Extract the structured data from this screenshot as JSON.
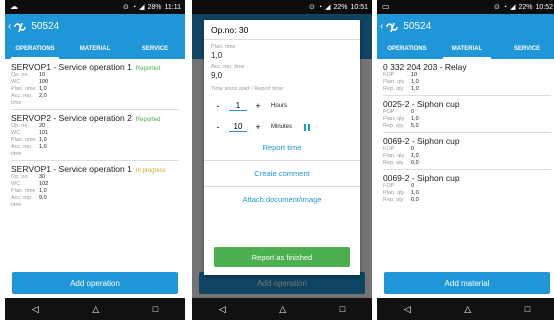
{
  "status_bar": [
    {
      "time": "11:11",
      "battery": "28%"
    },
    {
      "time": "10:51",
      "battery": "22%"
    },
    {
      "time": "10:52",
      "battery": "22%"
    }
  ],
  "app": {
    "title": "50524"
  },
  "tabs": [
    "OPERATIONS",
    "MATERIAL",
    "SERVICE"
  ],
  "operations": [
    {
      "name": "SERVOP1 - Service operation 1",
      "status": "Reported",
      "fields": [
        {
          "k": "Op. no.",
          "v": "10"
        },
        {
          "k": "WC",
          "v": "100"
        },
        {
          "k": "Plan. time",
          "v": "1,0"
        },
        {
          "k": "Acc. rep. time",
          "v": "2,0"
        }
      ]
    },
    {
      "name": "SERVOP2 - Service operation 2",
      "status": "Reported",
      "fields": [
        {
          "k": "Op. no.",
          "v": "20"
        },
        {
          "k": "WC",
          "v": "101"
        },
        {
          "k": "Plan. time",
          "v": "1,0"
        },
        {
          "k": "Acc. rep. time",
          "v": "1,0"
        }
      ]
    },
    {
      "name": "SERVOP1 - Service operation 1",
      "status": "In progress",
      "fields": [
        {
          "k": "Op. no.",
          "v": "30"
        },
        {
          "k": "WC",
          "v": "102"
        },
        {
          "k": "Plan. time",
          "v": "1,0"
        },
        {
          "k": "Acc. rep. time",
          "v": "9,0"
        }
      ]
    }
  ],
  "add_operation_label": "Add operation",
  "dialog": {
    "title": "Op.no: 30",
    "plan_time_label": "Plan. time",
    "plan_time_value": "1,0",
    "acc_rep_label": "Acc. rep. time",
    "acc_rep_value": "9,0",
    "time_since_label": "Time since start / Report time:",
    "hours_value": "1",
    "hours_label": "Hours",
    "minutes_value": "10",
    "minutes_label": "Minutes",
    "minus": "-",
    "plus": "+",
    "report_time": "Report time",
    "create_comment": "Create comment",
    "attach": "Attach document/image",
    "finish": "Report as finished"
  },
  "materials": [
    {
      "name": "0 332 204 203 - Relay",
      "fields": [
        {
          "k": "FOP",
          "v": "10"
        },
        {
          "k": "Plan. qty",
          "v": "1,0"
        },
        {
          "k": "Rep. qty",
          "v": "1,0"
        }
      ]
    },
    {
      "name": "0025-2 - Siphon cup",
      "fields": [
        {
          "k": "FOP",
          "v": "0"
        },
        {
          "k": "Plan. qty",
          "v": "1,0"
        },
        {
          "k": "Rep. qty",
          "v": "5,0"
        }
      ]
    },
    {
      "name": "0069-2 - Siphon cup",
      "fields": [
        {
          "k": "FOP",
          "v": "0"
        },
        {
          "k": "Plan. qty",
          "v": "1,0"
        },
        {
          "k": "Rep. qty",
          "v": "0,0"
        }
      ]
    },
    {
      "name": "0069-2 - Siphon cup",
      "fields": [
        {
          "k": "FOP",
          "v": "0"
        },
        {
          "k": "Plan. qty",
          "v": "1,0"
        },
        {
          "k": "Rep. qty",
          "v": "0,0"
        }
      ]
    }
  ],
  "add_material_label": "Add material",
  "colors": {
    "primary": "#1f96d8",
    "reported": "#4caf50",
    "in_progress": "#e0a020",
    "finish": "#4caf50"
  }
}
